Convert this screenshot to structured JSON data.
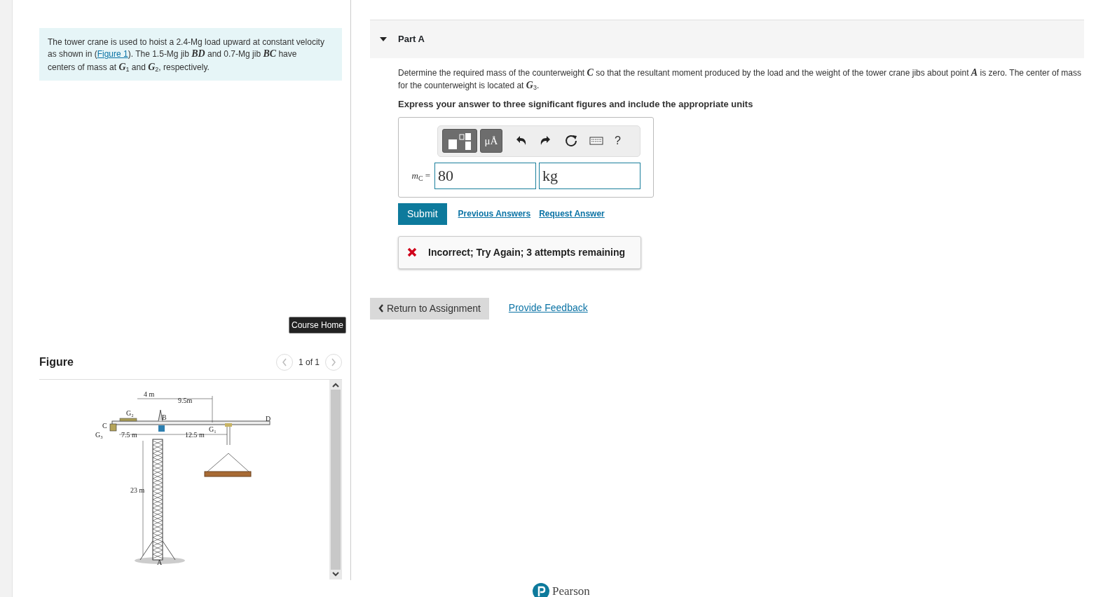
{
  "intro": {
    "before": "The tower crane is used to hoist a 2.4-Mg load upward at constant velocity as shown in (",
    "link": "Figure 1",
    "after": "). The 1.5-Mg jib *BD* and 0.7-Mg jib *BC* have centers of mass at *G*$_{1}$ and *G*$_{2}$, respectively."
  },
  "course_home": "Course Home",
  "figure": {
    "heading": "Figure",
    "pager": "1 of 1",
    "labels": [
      "4 m",
      "9.5m",
      "G₂",
      "B",
      "D",
      "C",
      "G₃",
      "7.5 m",
      "12.5 m",
      "G₁",
      "23 m",
      "A"
    ]
  },
  "part": {
    "title": "Part A",
    "expanded": true,
    "question": "Determine the required mass of the counterweight *C* so that the resultant moment produced by the load and the weight of the tower crane jibs about point *A* is zero. The center of mass for the counterweight is located at *G*$_{3}$.",
    "instruction": "Express your answer to three significant figures and include the appropriate units",
    "toolbar": {
      "units_button": "μÅ",
      "help": "?"
    },
    "answer_label": "*m*$_{C}$ =",
    "value": "80",
    "units": "kg",
    "submit": "Submit",
    "links": [
      "Previous Answers",
      "Request Answer"
    ],
    "feedback": {
      "correct": false,
      "text": "Incorrect; Try Again; 3 attempts remaining"
    }
  },
  "return_button": "Return to Assignment",
  "provide_feedback": "Provide Feedback",
  "footer_logo": "Pearson"
}
